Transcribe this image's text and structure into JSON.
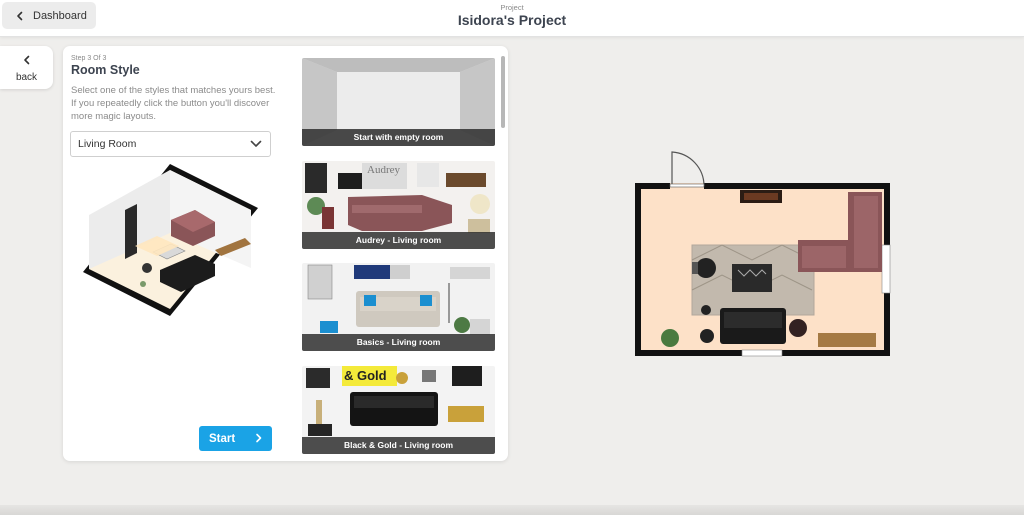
{
  "header": {
    "dashboard_label": "Dashboard",
    "project_kicker": "Project",
    "project_title": "Isidora's Project"
  },
  "back": {
    "label": "back"
  },
  "panel": {
    "step": "Step 3 Of 3",
    "heading": "Room Style",
    "description": "Select one of the styles that matches yours best. If you repeatedly click the button you'll discover more magic layouts.",
    "room_select": {
      "value": "Living Room"
    },
    "start_label": "Start"
  },
  "cards": [
    {
      "caption": "Start with empty room"
    },
    {
      "caption": "Audrey - Living room",
      "text_art": "Audrey"
    },
    {
      "caption": "Basics - Living room"
    },
    {
      "caption": "Black & Gold - Living room",
      "text_art": "& Gold"
    }
  ],
  "colors": {
    "accent": "#1aa3e6",
    "floor": "#fde1c8",
    "sofa": "#8a5558",
    "wall": "#111111"
  },
  "icons": [
    "chevron-left-icon",
    "chevron-down-icon",
    "chevron-right-icon"
  ]
}
